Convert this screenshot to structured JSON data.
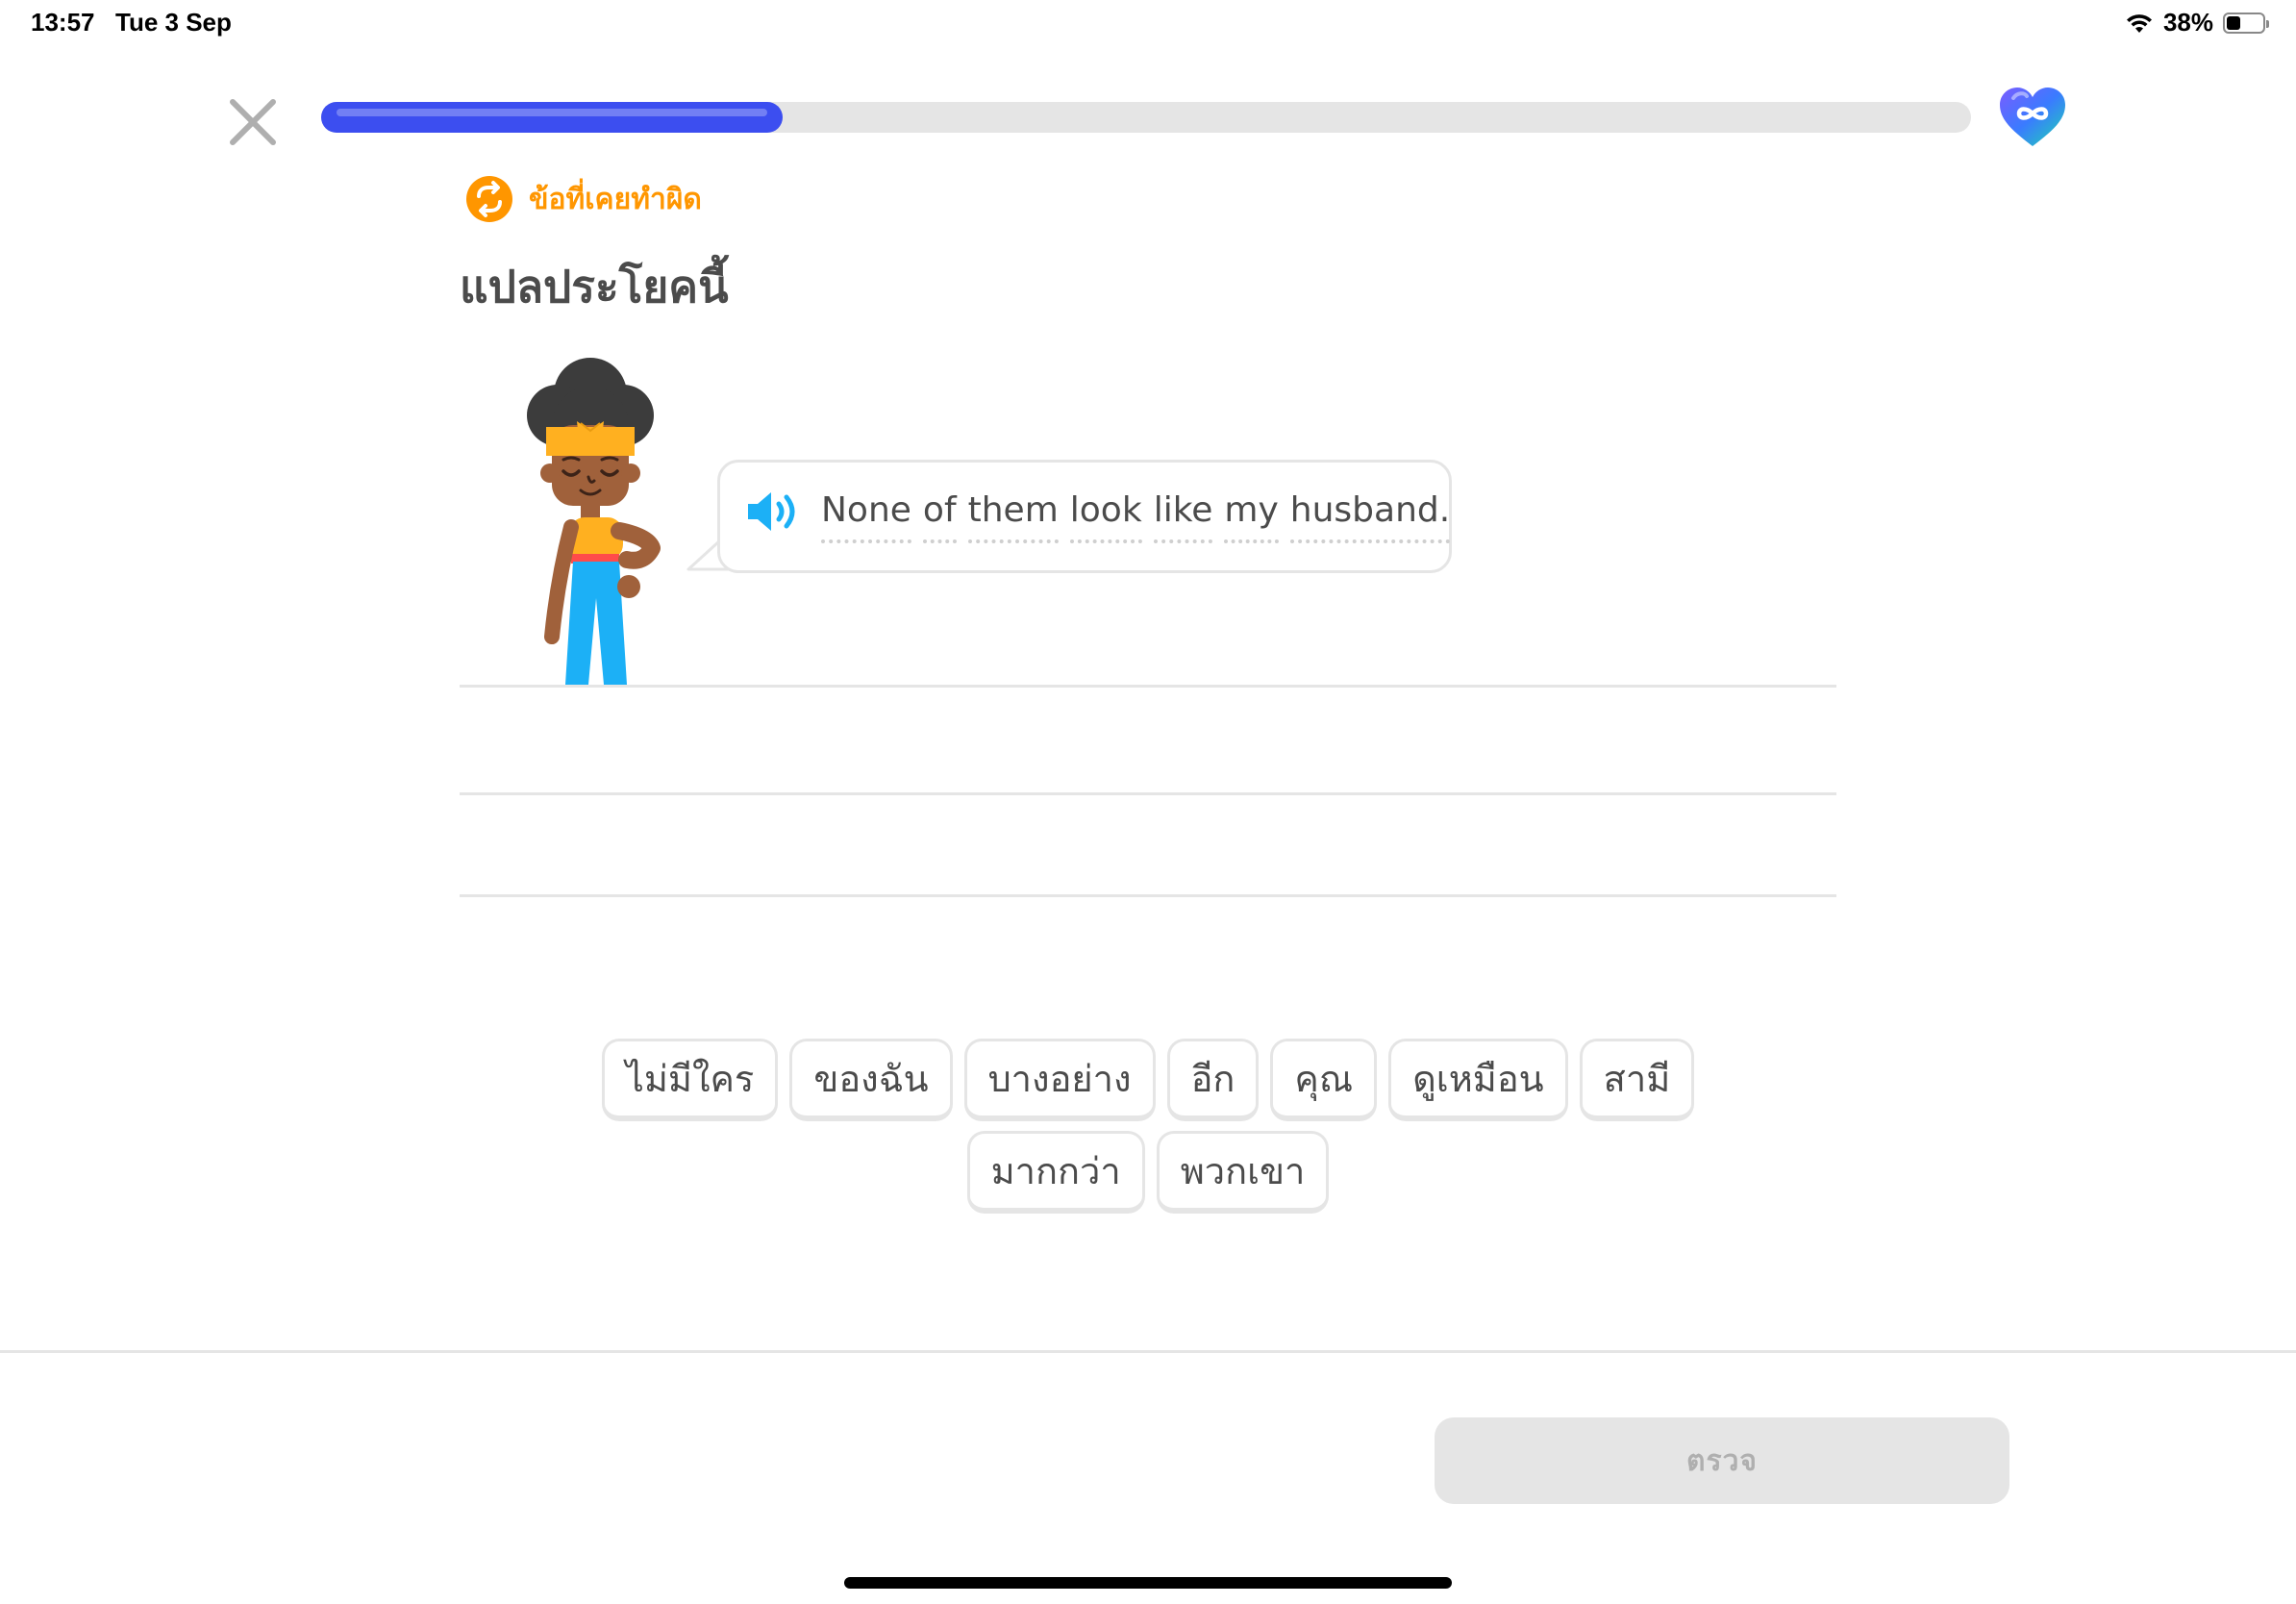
{
  "status_bar": {
    "time": "13:57",
    "date": "Tue 3 Sep",
    "battery": "38%"
  },
  "lesson": {
    "progress_fraction": 0.28,
    "hearts_icon": "infinity-heart-icon",
    "review_label": "ข้อที่เคยทำผิด",
    "prompt": "แปลประโยคนี้"
  },
  "sentence": {
    "words": [
      "None",
      "of",
      "them",
      "look",
      "like",
      "my",
      "husband."
    ]
  },
  "word_bank": [
    "ไม่มีใคร",
    "ของฉัน",
    "บางอย่าง",
    "อีก",
    "คุณ",
    "ดูเหมือน",
    "สามี",
    "มากกว่า",
    "พวกเขา"
  ],
  "footer": {
    "check_label": "ตรวจ"
  },
  "colors": {
    "progress": "#3c4ef0",
    "review_orange": "#ff9600",
    "speaker_blue": "#1cb0f6",
    "tile_border": "#e5e5e5",
    "disabled_button": "#e5e5e5"
  }
}
